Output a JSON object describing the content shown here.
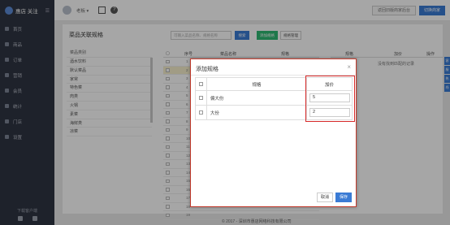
{
  "brand": {
    "name": "惠店 关注",
    "toggle": "☰"
  },
  "sidebar": {
    "items": [
      {
        "label": "首页"
      },
      {
        "label": "商品"
      },
      {
        "label": "订单"
      },
      {
        "label": "营销"
      },
      {
        "label": "会员"
      },
      {
        "label": "统计"
      },
      {
        "label": "门店"
      },
      {
        "label": "设置"
      }
    ],
    "bottom_label": "下载客户端"
  },
  "topbar": {
    "user": "老板 ▾",
    "help": "?",
    "back_label": "返回旧版商家后台",
    "switch_label": "切换商家"
  },
  "panel": {
    "title": "菜品关联规格",
    "search_placeholder": "可输入菜品名称、规格名称",
    "search_label": "搜索",
    "add_label": "添加规格",
    "manage_label": "规格管理",
    "category_header": "菜品类别",
    "categories": [
      "酒水饮料",
      "默认菜品",
      "家常",
      "特色菜",
      "肉类",
      "火锅",
      "素菜",
      "海鲜类",
      "凉菜"
    ],
    "grid_headers": {
      "no": "序号",
      "name": "菜品名称",
      "spec": "规格"
    },
    "row_numbers": [
      "1",
      "2",
      "3",
      "4",
      "5",
      "6",
      "7",
      "8",
      "9",
      "10",
      "11",
      "12",
      "13",
      "14",
      "15",
      "16",
      "17",
      "18",
      "19"
    ],
    "right_headers": {
      "spec": "规格",
      "price": "加价",
      "op": "操作"
    },
    "right_empty": "没有找到匹配的记录"
  },
  "footer": "© 2017 - 深圳市惠店网络科技有限公司",
  "side_tabs": [
    "客",
    "服",
    "热",
    "线"
  ],
  "modal": {
    "title": "添加规格",
    "close": "×",
    "headers": {
      "spec": "规格",
      "price": "加价"
    },
    "rows": [
      {
        "spec": "偏大份",
        "price": "5"
      },
      {
        "spec": "大份",
        "price": "2"
      }
    ],
    "cancel_label": "取消",
    "save_label": "保存"
  }
}
